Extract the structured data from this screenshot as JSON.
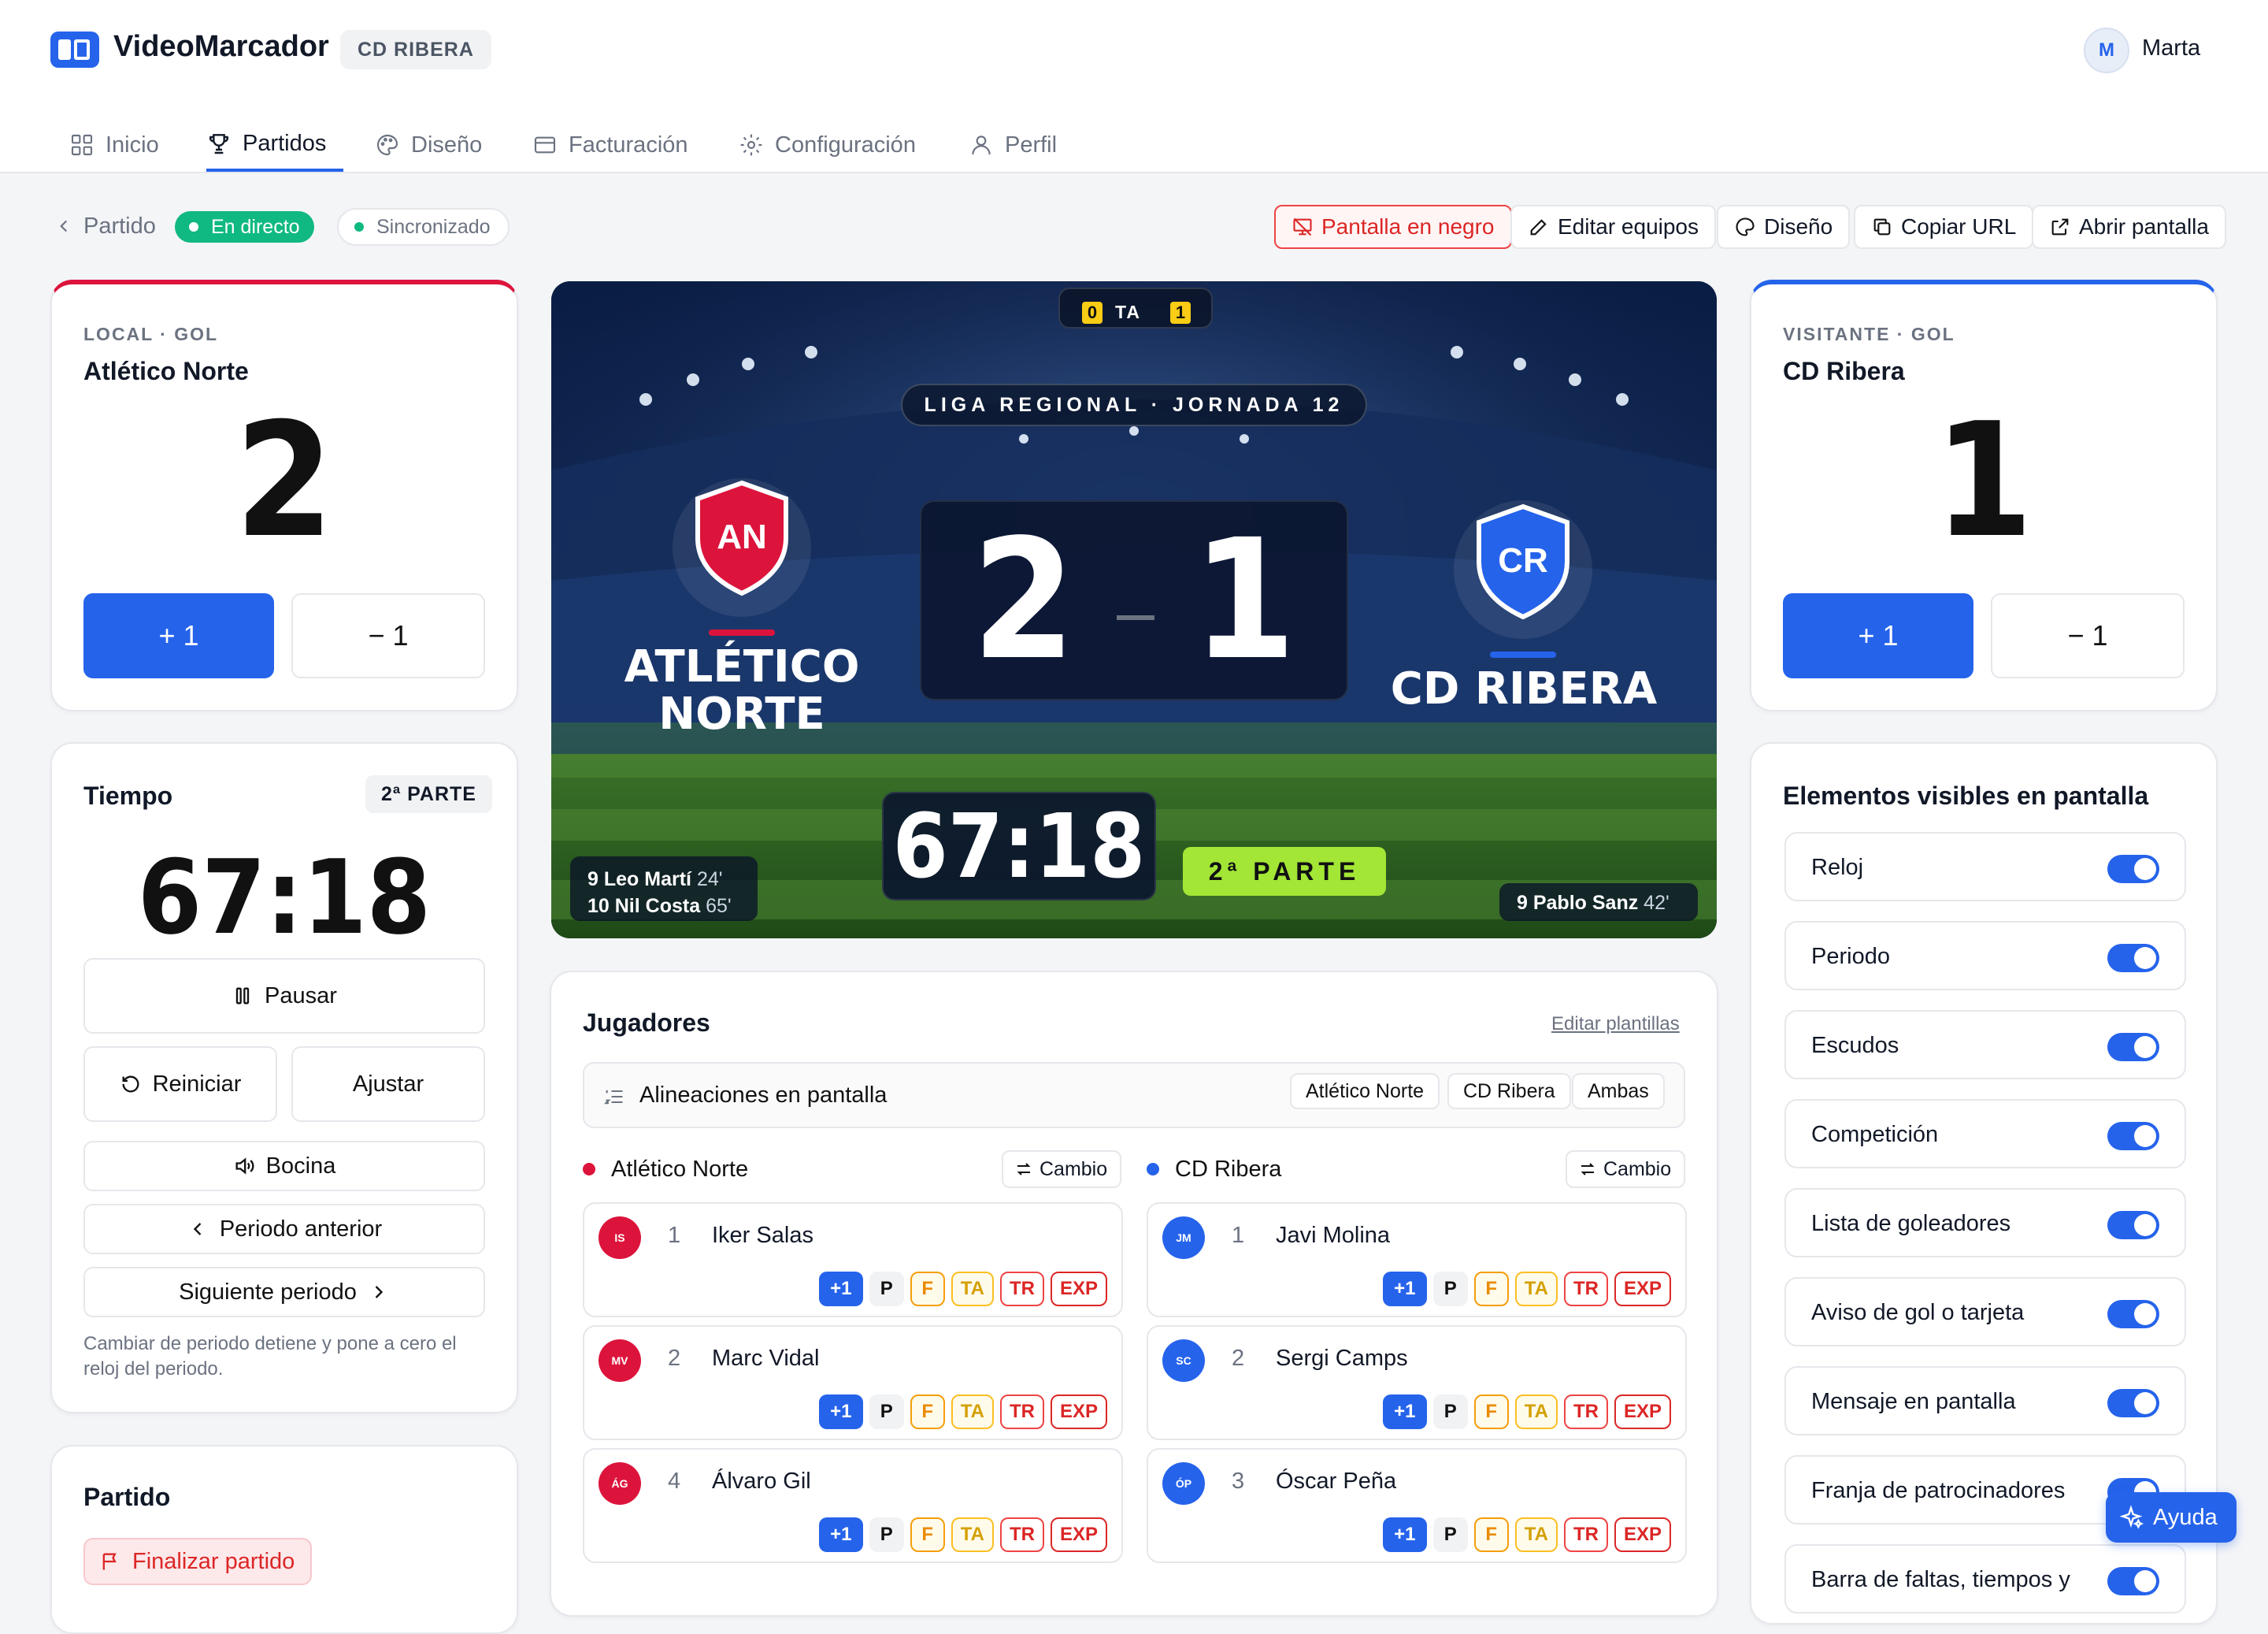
{
  "app": {
    "brand": "VideoMarcador",
    "club_tag": "CD RIBERA",
    "user_initial": "M",
    "user_name": "Marta"
  },
  "nav": [
    {
      "label": "Inicio",
      "icon": "grid-icon"
    },
    {
      "label": "Partidos",
      "icon": "trophy-icon",
      "active": true
    },
    {
      "label": "Diseño",
      "icon": "palette-icon"
    },
    {
      "label": "Facturación",
      "icon": "card-icon"
    },
    {
      "label": "Configuración",
      "icon": "gear-icon"
    },
    {
      "label": "Perfil",
      "icon": "user-icon"
    }
  ],
  "subbar": {
    "back_label": "Partido",
    "live": "En directo",
    "sync": "Sincronizado",
    "actions": [
      "Pantalla en negro",
      "Editar equipos",
      "Diseño",
      "Copiar URL",
      "Abrir pantalla"
    ]
  },
  "home": {
    "caption": "LOCAL · GOL",
    "name": "Atlético Norte",
    "score": "2",
    "plus": "+ 1",
    "minus": "− 1",
    "crest": "AN",
    "screen_name_1": "ATLÉTICO",
    "screen_name_2": "NORTE",
    "color": "#dc143c"
  },
  "away": {
    "caption": "VISITANTE · GOL",
    "name": "CD Ribera",
    "score": "1",
    "plus": "+ 1",
    "minus": "− 1",
    "crest": "CR",
    "screen_name": "CD RIBERA",
    "color": "#2563eb"
  },
  "timer": {
    "title": "Tiempo",
    "period_badge": "2ª PARTE",
    "clock": "67:18",
    "pause": "Pausar",
    "reset": "Reiniciar",
    "adjust": "Ajustar",
    "horn": "Bocina",
    "prev": "Periodo anterior",
    "next": "Siguiente periodo",
    "note": "Cambiar de periodo detiene y pone a cero el reloj del periodo."
  },
  "match": {
    "title": "Partido",
    "finish": "Finalizar partido"
  },
  "screen": {
    "cards_home": "0",
    "cards_label": "TA",
    "cards_away": "1",
    "competition": "LIGA REGIONAL · JORNADA 12",
    "score_home": "2",
    "score_away": "1",
    "clock": "67:18",
    "period": "2ª PARTE",
    "home_scorers": [
      {
        "name": "9 Leo Martí",
        "min": "24'"
      },
      {
        "name": "10 Nil Costa",
        "min": "65'"
      }
    ],
    "away_scorers": [
      {
        "name": "9 Pablo Sanz",
        "min": "42'"
      }
    ]
  },
  "players": {
    "title": "Jugadores",
    "edit": "Editar plantillas",
    "lineups_label": "Alineaciones en pantalla",
    "lineup_options": [
      "Atlético Norte",
      "CD Ribera",
      "Ambas"
    ],
    "change": "Cambio",
    "home_team": "Atlético Norte",
    "away_team": "CD Ribera",
    "actions": [
      "+1",
      "P",
      "F",
      "TA",
      "TR",
      "EXP"
    ],
    "home": [
      {
        "initials": "IS",
        "num": "1",
        "name": "Iker Salas"
      },
      {
        "initials": "MV",
        "num": "2",
        "name": "Marc Vidal"
      },
      {
        "initials": "ÁG",
        "num": "4",
        "name": "Álvaro Gil"
      }
    ],
    "away": [
      {
        "initials": "JM",
        "num": "1",
        "name": "Javi Molina"
      },
      {
        "initials": "SC",
        "num": "2",
        "name": "Sergi Camps"
      },
      {
        "initials": "ÓP",
        "num": "3",
        "name": "Óscar Peña"
      }
    ]
  },
  "visible": {
    "title": "Elementos visibles en pantalla",
    "items": [
      "Reloj",
      "Periodo",
      "Escudos",
      "Competición",
      "Lista de goleadores",
      "Aviso de gol o tarjeta",
      "Mensaje en pantalla",
      "Franja de patrocinadores",
      "Barra de faltas, tiempos y"
    ]
  },
  "help": "Ayuda"
}
